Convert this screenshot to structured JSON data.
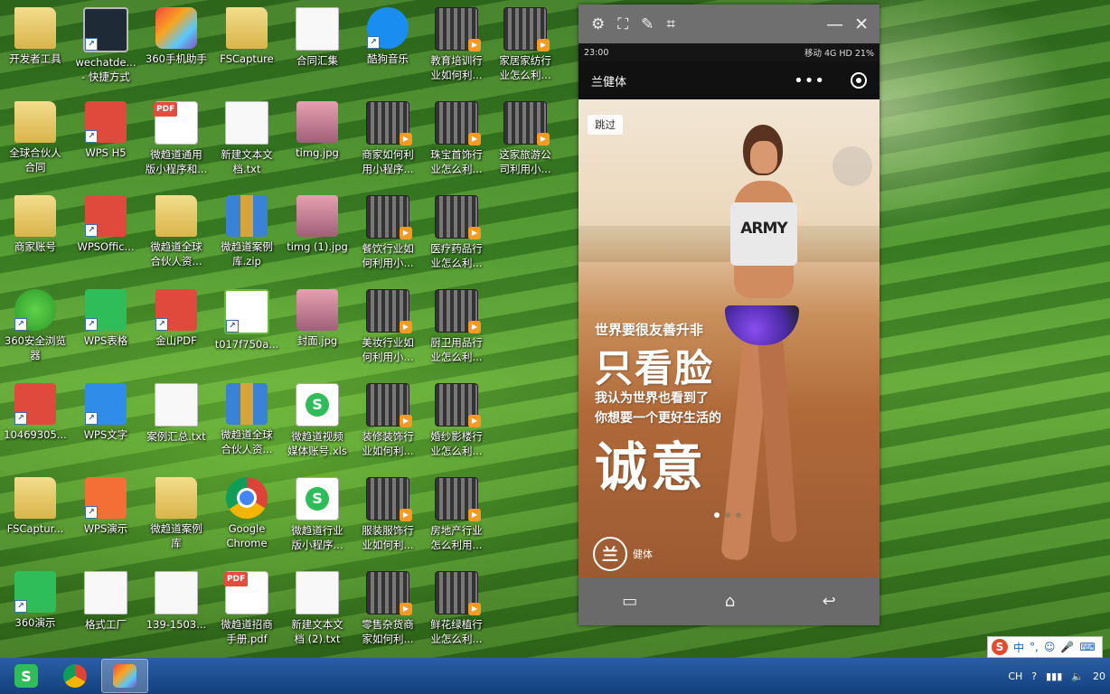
{
  "desktop": {
    "icons": [
      {
        "label": "开发者工具",
        "type": "folder"
      },
      {
        "label": "wechatde...\n- 快捷方式",
        "type": "term"
      },
      {
        "label": "360手机助手",
        "type": "wechat360"
      },
      {
        "label": "FSCapture",
        "type": "folder"
      },
      {
        "label": "合同汇集",
        "type": "doc"
      },
      {
        "label": "酷狗音乐",
        "type": "kugou"
      },
      {
        "label": "教育培训行\n业如何利...",
        "type": "video"
      },
      {
        "label": "家居家纺行\n业怎么利...",
        "type": "video"
      },
      {
        "label": "全球合伙人\n合同",
        "type": "folder"
      },
      {
        "label": "WPS H5",
        "type": "wps-red"
      },
      {
        "label": "微趋道通用\n版小程序和...",
        "type": "pdf"
      },
      {
        "label": "新建文本文\n档.txt",
        "type": "doc"
      },
      {
        "label": "timg.jpg",
        "type": "img"
      },
      {
        "label": "商家如何利\n用小程序...",
        "type": "video"
      },
      {
        "label": "珠宝首饰行\n业怎么利...",
        "type": "video"
      },
      {
        "label": "这家旅游公\n司利用小...",
        "type": "video"
      },
      {
        "label": "商家账号",
        "type": "folder"
      },
      {
        "label": "WPSOffic...",
        "type": "wps-red"
      },
      {
        "label": "微趋道全球\n合伙人资...",
        "type": "folder"
      },
      {
        "label": "微趋道案例\n库.zip",
        "type": "zip"
      },
      {
        "label": "timg (1).jpg",
        "type": "img"
      },
      {
        "label": "餐饮行业如\n何利用小...",
        "type": "video"
      },
      {
        "label": "医疗药品行\n业怎么利...",
        "type": "video"
      },
      {
        "label": "",
        "type": "none"
      },
      {
        "label": "360安全浏览\n器",
        "type": "app360"
      },
      {
        "label": "WPS表格",
        "type": "wps-green"
      },
      {
        "label": "金山PDF",
        "type": "wps-red"
      },
      {
        "label": "t017f750a...",
        "type": "vertify"
      },
      {
        "label": "封面.jpg",
        "type": "img"
      },
      {
        "label": "美妆行业如\n何利用小...",
        "type": "video"
      },
      {
        "label": "厨卫用品行\n业怎么利...",
        "type": "video"
      },
      {
        "label": "",
        "type": "none"
      },
      {
        "label": "10469305...",
        "type": "wps-red"
      },
      {
        "label": "WPS文字",
        "type": "wps-blue"
      },
      {
        "label": "案例汇总.txt",
        "type": "doc"
      },
      {
        "label": "微趋道全球\n合伙人资...",
        "type": "zip"
      },
      {
        "label": "微趋道视频\n媒体账号.xls",
        "type": "xls"
      },
      {
        "label": "装修装饰行\n业如何利...",
        "type": "video"
      },
      {
        "label": "婚纱影楼行\n业怎么利...",
        "type": "video"
      },
      {
        "label": "",
        "type": "none"
      },
      {
        "label": "FSCaptur...",
        "type": "folder"
      },
      {
        "label": "WPS演示",
        "type": "wps-orange"
      },
      {
        "label": "微趋道案例\n库",
        "type": "folder"
      },
      {
        "label": "Google\nChrome",
        "type": "chrome"
      },
      {
        "label": "微趋道行业\n版小程序...",
        "type": "xls"
      },
      {
        "label": "服装服饰行\n业如何利...",
        "type": "video"
      },
      {
        "label": "房地产行业\n怎么利用...",
        "type": "video"
      },
      {
        "label": "",
        "type": "none"
      },
      {
        "label": "360演示",
        "type": "wps-green"
      },
      {
        "label": "格式工厂",
        "type": "doc"
      },
      {
        "label": "139-1503...",
        "type": "doc"
      },
      {
        "label": "微趋道招商\n手册.pdf",
        "type": "pdf"
      },
      {
        "label": "新建文本文\n档 (2).txt",
        "type": "doc"
      },
      {
        "label": "零售杂货商\n家如何利...",
        "type": "video"
      },
      {
        "label": "鲜花绿植行\n业怎么利...",
        "type": "video"
      },
      {
        "label": "",
        "type": "none"
      }
    ]
  },
  "phone": {
    "status_time": "23:00",
    "status_right": "移动 4G HD 21%",
    "app_title": "兰健体",
    "skip_label": "跳过",
    "top_line": "ARMY",
    "slogan": {
      "line1": "世界要很友善升非",
      "line2": "只看脸",
      "line3": "我认为世界也看到了",
      "line4": "你想要一个更好生活的",
      "line5": "诚意"
    },
    "brand_seal": "兰",
    "brand_text": "健体"
  },
  "ime": {
    "items": [
      "中",
      "°,",
      "☺",
      "🎤",
      "⌨"
    ]
  },
  "tray": {
    "items": [
      "CH",
      "?",
      "20"
    ]
  }
}
